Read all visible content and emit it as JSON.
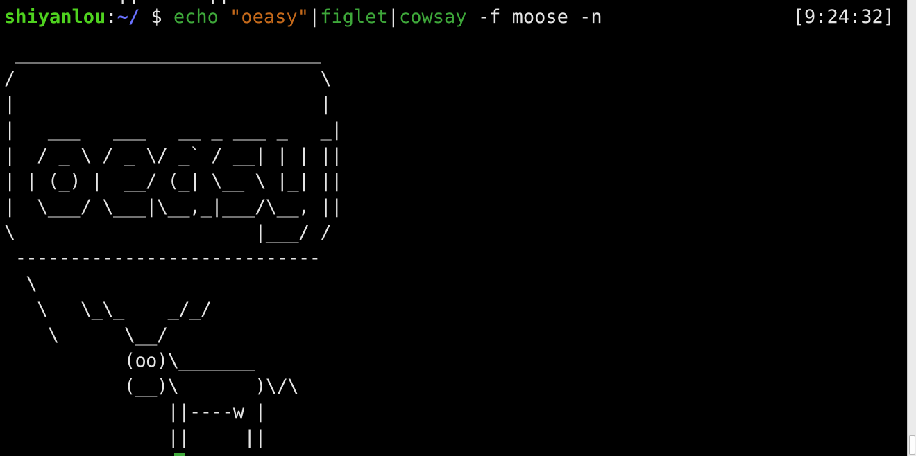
{
  "terminal": {
    "top_fragment": "          ||      ||",
    "prompt": {
      "user": "shiyanlou",
      "colon": ":",
      "path": "~/",
      "dollar": " $ "
    },
    "command": {
      "part_echo": "echo ",
      "part_string": "\"oeasy\"",
      "pipe1": "|",
      "part_figlet": "figlet",
      "pipe2": "|",
      "part_cowsay": "cowsay",
      "part_args": " -f moose -n"
    },
    "clock": "[9:24:32]",
    "output": " ____________________________\n/                            \\\n|                            |\n|   ___   ___   __ _ ___ _   _|\n|  / _ \\ / _ \\/ _` / __| | | ||\n| | (_) |  __/ (_| \\__ \\ |_| ||\n|  \\___/ \\___|\\__,_|___/\\__, ||\n\\                      |___/ /\n ----------------------------\n  \\\n   \\   \\_\\_    _/_/\n    \\      \\__/\n           (oo)\\_______\n           (__)\\       )\\/\\\n               ||----w |\n               ||     ||"
  },
  "colors": {
    "background": "#000000",
    "user": "#4fd21f",
    "path": "#6a72ff",
    "command": "#3ea83a",
    "string": "#c66a1b",
    "text": "#e5e5e5"
  }
}
